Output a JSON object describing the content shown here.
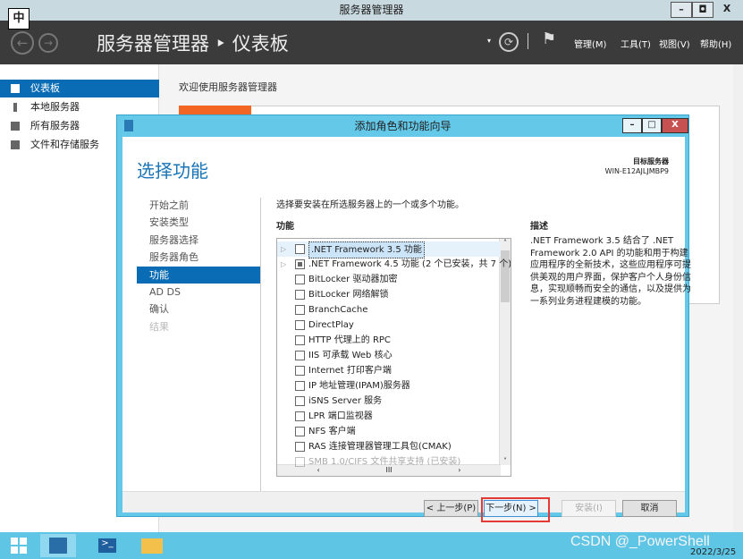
{
  "window": {
    "title": "服务器管理器",
    "min": "–",
    "max": "◘",
    "close": "X"
  },
  "ime": "中",
  "header": {
    "breadcrumb": "服务器管理器 ‣ 仪表板",
    "menus": [
      "管理(M)",
      "工具(T)",
      "视图(V)",
      "帮助(H)"
    ]
  },
  "sidebar": {
    "items": [
      {
        "label": "仪表板"
      },
      {
        "label": "本地服务器"
      },
      {
        "label": "所有服务器"
      },
      {
        "label": "文件和存储服务"
      }
    ]
  },
  "welcome": "欢迎使用服务器管理器",
  "dialog": {
    "title": "添加角色和功能向导",
    "heading": "选择功能",
    "target_label": "目标服务器",
    "target_server": "WIN-E12AJLJMBP9",
    "nav": [
      "开始之前",
      "安装类型",
      "服务器选择",
      "服务器角色",
      "功能",
      "AD DS",
      "确认",
      "结果"
    ],
    "instruction": "选择要安装在所选服务器上的一个或多个功能。",
    "features_label": "功能",
    "desc_label": "描述",
    "description": ".NET Framework 3.5 结合了 .NET Framework 2.0 API 的功能和用于构建应用程序的全新技术，这些应用程序可提供美观的用户界面，保护客户个人身份信息，实现顺畅而安全的通信，以及提供为一系列业务进程建模的功能。",
    "features": [
      ".NET Framework 3.5 功能",
      ".NET Framework 4.5 功能 (2 个已安装，共 7 个)",
      "BitLocker 驱动器加密",
      "BitLocker 网络解锁",
      "BranchCache",
      "DirectPlay",
      "HTTP 代理上的 RPC",
      "IIS 可承载 Web 核心",
      "Internet 打印客户端",
      "IP 地址管理(IPAM)服务器",
      "iSNS Server 服务",
      "LPR 端口监视器",
      "NFS 客户端",
      "RAS 连接管理器管理工具包(CMAK)",
      "SMB 1.0/CIFS 文件共享支持 (已安装)"
    ],
    "buttons": {
      "prev": "< 上一步(P)",
      "next": "下一步(N) >",
      "install": "安装(I)",
      "cancel": "取消"
    }
  },
  "watermark": "CSDN @_PowerShell",
  "date": "2022/3/25"
}
